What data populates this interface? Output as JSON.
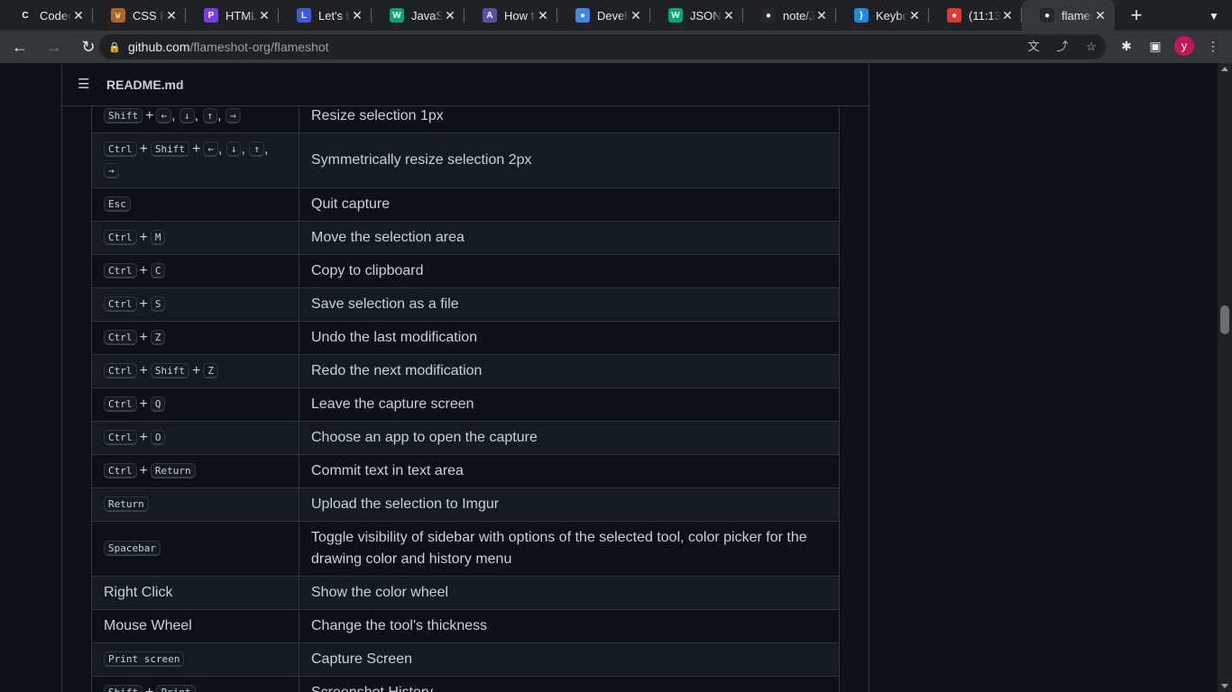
{
  "browser": {
    "tabs": [
      {
        "title": "Codec",
        "icon": "codecademy-icon",
        "color": "#202124",
        "glyph": "C"
      },
      {
        "title": "CSS F",
        "icon": "css-owl-icon",
        "color": "#b5651d",
        "glyph": "🦉"
      },
      {
        "title": "HTML",
        "icon": "html-icon",
        "color": "#7c3aed",
        "glyph": "P"
      },
      {
        "title": "Let's b",
        "icon": "lets-build-icon",
        "color": "#3b5bdb",
        "glyph": "L"
      },
      {
        "title": "JavaSc",
        "icon": "w3-icon",
        "color": "#04aa6d",
        "glyph": "W"
      },
      {
        "title": "How to",
        "icon": "how-to-icon",
        "color": "#5b4fa8",
        "glyph": "A"
      },
      {
        "title": "Develo",
        "icon": "chrome-icon",
        "color": "#4285f4",
        "glyph": "●"
      },
      {
        "title": "JSON",
        "icon": "w3-icon",
        "color": "#04aa6d",
        "glyph": "W"
      },
      {
        "title": "note/J",
        "icon": "github-icon",
        "color": "#24292f",
        "glyph": "●"
      },
      {
        "title": "Keybo",
        "icon": "keyboard-icon",
        "color": "#1e88e5",
        "glyph": "}"
      },
      {
        "title": "(11:13)",
        "icon": "tomato-icon",
        "color": "#e53935",
        "glyph": "●"
      },
      {
        "title": "flames",
        "icon": "github-icon",
        "color": "#24292f",
        "glyph": "●"
      }
    ],
    "url_host": "github.com",
    "url_path": "/flameshot-org/flameshot",
    "avatar_letter": "y"
  },
  "readme": {
    "filename": "README.md"
  },
  "shortcuts": [
    {
      "keys": [
        "Shift",
        "+",
        "←",
        ",",
        "↓",
        ",",
        "↑",
        ",",
        "→"
      ],
      "action": "Resize selection 1px"
    },
    {
      "keys": [
        "Ctrl",
        "+",
        "Shift",
        "+",
        "←",
        ",",
        "↓",
        ",",
        "↑",
        ",",
        "→"
      ],
      "action": "Symmetrically resize selection 2px"
    },
    {
      "keys": [
        "Esc"
      ],
      "action": "Quit capture"
    },
    {
      "keys": [
        "Ctrl",
        "+",
        "M"
      ],
      "action": "Move the selection area"
    },
    {
      "keys": [
        "Ctrl",
        "+",
        "C"
      ],
      "action": "Copy to clipboard"
    },
    {
      "keys": [
        "Ctrl",
        "+",
        "S"
      ],
      "action": "Save selection as a file"
    },
    {
      "keys": [
        "Ctrl",
        "+",
        "Z"
      ],
      "action": "Undo the last modification"
    },
    {
      "keys": [
        "Ctrl",
        "+",
        "Shift",
        "+",
        "Z"
      ],
      "action": "Redo the next modification"
    },
    {
      "keys": [
        "Ctrl",
        "+",
        "Q"
      ],
      "action": "Leave the capture screen"
    },
    {
      "keys": [
        "Ctrl",
        "+",
        "O"
      ],
      "action": "Choose an app to open the capture"
    },
    {
      "keys": [
        "Ctrl",
        "+",
        "Return"
      ],
      "action": "Commit text in text area"
    },
    {
      "keys": [
        "Return"
      ],
      "action": "Upload the selection to Imgur"
    },
    {
      "keys": [
        "Spacebar"
      ],
      "action": "Toggle visibility of sidebar with options of the selected tool, color picker for the drawing color and history menu"
    },
    {
      "text": "Right Click",
      "action": "Show the color wheel"
    },
    {
      "text": "Mouse Wheel",
      "action": "Change the tool's thickness"
    },
    {
      "keys": [
        "Print screen"
      ],
      "action": "Capture Screen"
    },
    {
      "keys": [
        "Shift",
        "+",
        "Print"
      ],
      "action": "Screenshot History"
    }
  ]
}
